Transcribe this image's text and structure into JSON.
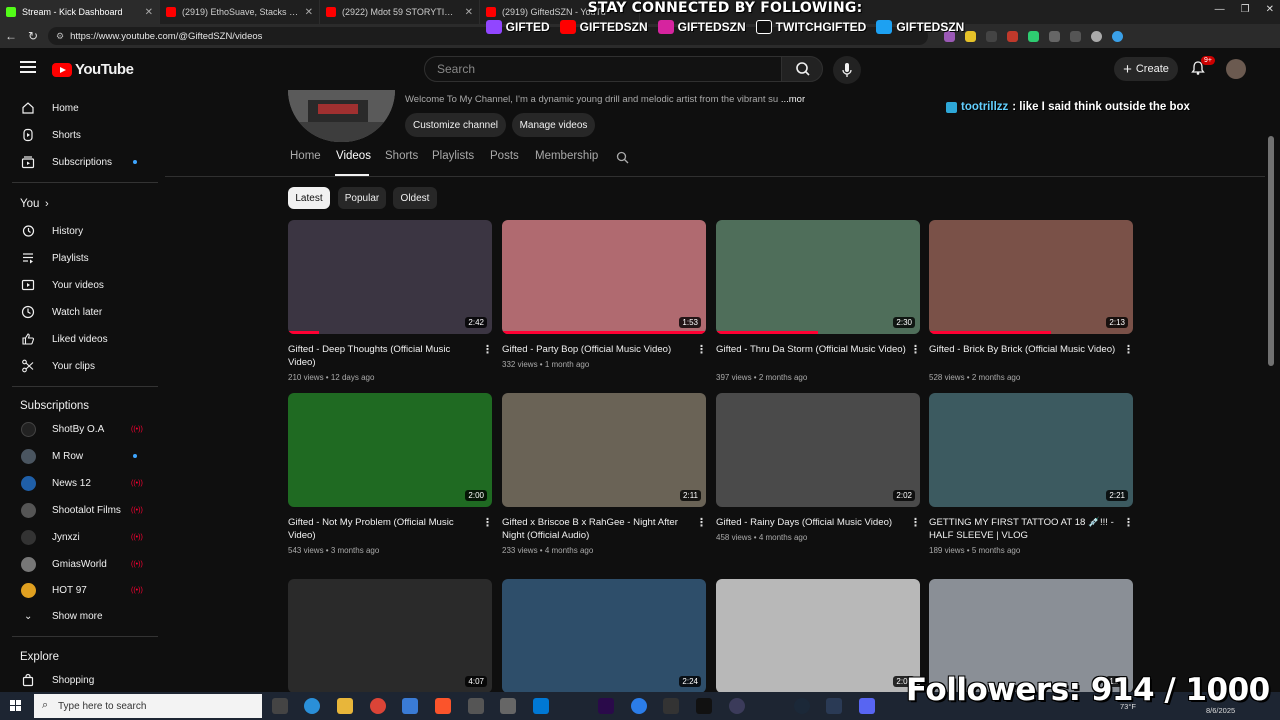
{
  "browser": {
    "tabs": [
      {
        "title": "Stream - Kick Dashboard",
        "color": "#53fc18"
      },
      {
        "title": "(2919) EthoSuave, Stacks BW, Ch",
        "color": "#ff0000"
      },
      {
        "title": "(2922) Mdot 59 STORYTIME On B",
        "color": "#ff0000"
      },
      {
        "title": "(2919) GiftedSZN - YouTu",
        "color": "#ff0000"
      }
    ],
    "url": "https://www.youtube.com/@GiftedSZN/videos"
  },
  "overlay": {
    "headline": "STAY CONNECTED BY FOLLOWING:",
    "socials": [
      {
        "handle": "GIFTED",
        "icon": "twitch-icon",
        "color": "#9146ff"
      },
      {
        "handle": "GIFTEDSZN",
        "icon": "youtube-icon",
        "color": "#ff0000"
      },
      {
        "handle": "GIFTEDSZN",
        "icon": "instagram-icon",
        "color": "#d6249f"
      },
      {
        "handle": "TWITCHGIFTED",
        "icon": "tiktok-icon",
        "color": "#111111"
      },
      {
        "handle": "GIFTEDSZN",
        "icon": "twitter-icon",
        "color": "#1da1f2"
      }
    ],
    "chat": {
      "user": "tootrillzz",
      "message": ": like I said think outside the box"
    },
    "followers": "Followers: 914 / 1000"
  },
  "header": {
    "logo": "YouTube",
    "search_placeholder": "Search",
    "create_label": "Create",
    "notif_count": "9+"
  },
  "sidebar": {
    "main": [
      "Home",
      "Shorts",
      "Subscriptions"
    ],
    "you_label": "You",
    "you_items": [
      "History",
      "Playlists",
      "Your videos",
      "Watch later",
      "Liked videos",
      "Your clips"
    ],
    "subscriptions_label": "Subscriptions",
    "subscriptions": [
      {
        "name": "ShotBy O.A",
        "status": "live",
        "color": "#222222"
      },
      {
        "name": "M Row",
        "status": "dot",
        "color": "#4a5560"
      },
      {
        "name": "News 12",
        "status": "live",
        "color": "#1f5fa8"
      },
      {
        "name": "Shootalot Films",
        "status": "live",
        "color": "#555555"
      },
      {
        "name": "Jynxzi",
        "status": "live",
        "color": "#333333"
      },
      {
        "name": "GmiasWorld",
        "status": "live",
        "color": "#777777"
      },
      {
        "name": "HOT 97",
        "status": "live",
        "color": "#e0a020"
      }
    ],
    "show_more": "Show more",
    "explore_label": "Explore",
    "explore_items": [
      "Shopping"
    ]
  },
  "channel": {
    "description": "Welcome To My Channel, I'm a dynamic young drill and melodic artist from the vibrant su",
    "more": "...more",
    "customize": "Customize channel",
    "manage": "Manage videos",
    "tabs": [
      "Home",
      "Videos",
      "Shorts",
      "Playlists",
      "Posts",
      "Membership"
    ],
    "active_tab": "Videos",
    "chips": [
      "Latest",
      "Popular",
      "Oldest"
    ]
  },
  "videos": [
    {
      "title": "Gifted - Deep Thoughts (Official Music Video)",
      "meta": "210 views • 12 days ago",
      "duration": "2:42",
      "watched": 0.15,
      "bg": "#3b3542"
    },
    {
      "title": "Gifted - Party Bop (Official Music Video)",
      "meta": "332 views • 1 month ago",
      "duration": "1:53",
      "watched": 1.0,
      "bg": "#b06a70"
    },
    {
      "title": "Gifted - Thru Da Storm (Official Music Video)",
      "meta": "397 views • 2 months ago",
      "duration": "2:30",
      "watched": 0.5,
      "bg": "#4f6e5a"
    },
    {
      "title": "Gifted - Brick By Brick (Official Music Video)",
      "meta": "528 views • 2 months ago",
      "duration": "2:13",
      "watched": 0.6,
      "bg": "#7a5148"
    },
    {
      "title": "Gifted - Not My Problem (Official Music Video)",
      "meta": "543 views • 3 months ago",
      "duration": "2:00",
      "watched": 0.0,
      "bg": "#1f6a22"
    },
    {
      "title": "Gifted x Briscoe B x RahGee - Night After Night (Official Audio)",
      "meta": "233 views • 4 months ago",
      "duration": "2:11",
      "watched": 0.0,
      "bg": "#6a6356"
    },
    {
      "title": "Gifted - Rainy Days (Official Music Video)",
      "meta": "458 views • 4 months ago",
      "duration": "2:02",
      "watched": 0.0,
      "bg": "#4a4a4a"
    },
    {
      "title": "GETTING MY FIRST TATTOO AT 18 💉!!! - HALF SLEEVE | VLOG",
      "meta": "189 views • 5 months ago",
      "duration": "2:21",
      "watched": 0.0,
      "bg": "#3c5a60"
    },
    {
      "title": "",
      "meta": "",
      "duration": "4:07",
      "watched": 0.0,
      "bg": "#2a2a2a"
    },
    {
      "title": "",
      "meta": "",
      "duration": "2:24",
      "watched": 0.0,
      "bg": "#2e4e6a"
    },
    {
      "title": "",
      "meta": "",
      "duration": "2:03",
      "watched": 0.0,
      "bg": "#b8b8b8"
    },
    {
      "title": "",
      "meta": "",
      "duration": "1:58",
      "watched": 0.0,
      "bg": "#8a8f96"
    }
  ],
  "taskbar": {
    "search_placeholder": "Type here to search",
    "temp": "73°F",
    "date": "8/6/2025"
  }
}
